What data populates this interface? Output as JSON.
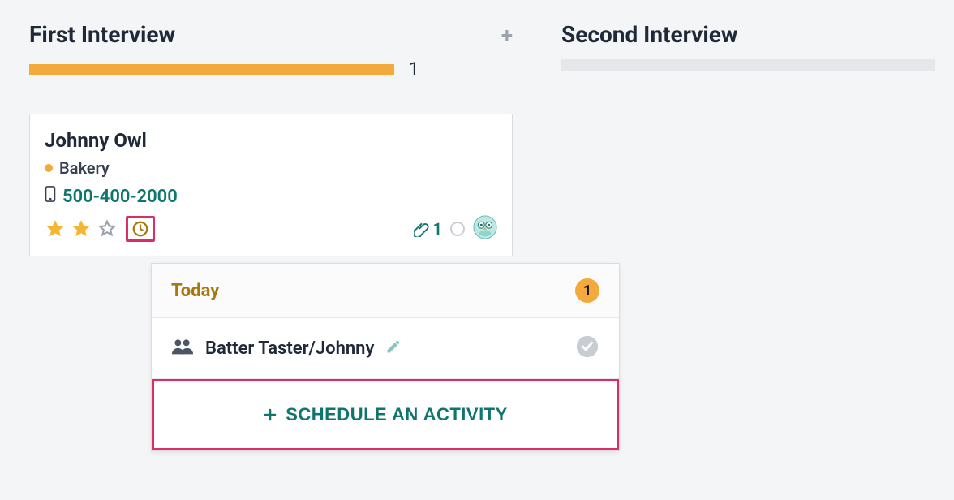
{
  "columns": {
    "first": {
      "title": "First Interview",
      "count": "1"
    },
    "second": {
      "title": "Second Interview"
    }
  },
  "card": {
    "name": "Johnny Owl",
    "tag": "Bakery",
    "phone": "500-400-2000",
    "attachments": "1"
  },
  "popover": {
    "today_label": "Today",
    "today_count": "1",
    "activity_title": "Batter Taster/Johnny",
    "schedule_label": "SCHEDULE AN ACTIVITY"
  }
}
